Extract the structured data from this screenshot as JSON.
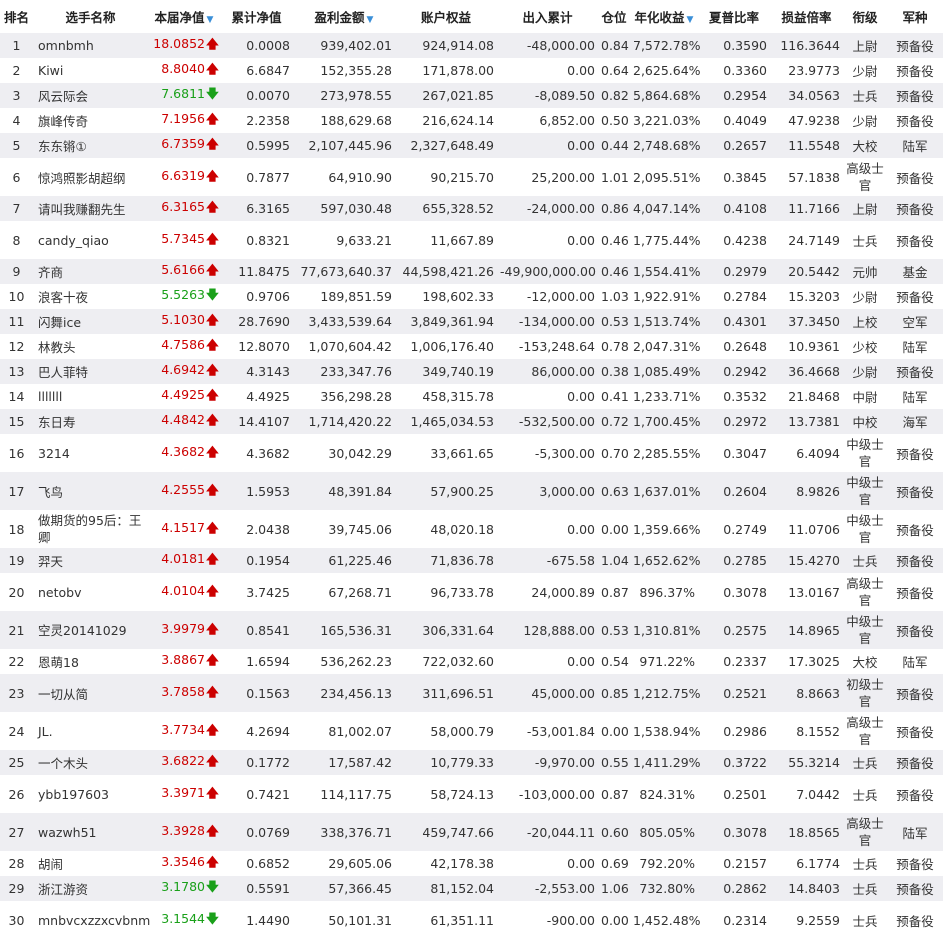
{
  "columns": {
    "rank": "排名",
    "name": "选手名称",
    "nav": "本届净值",
    "cum_nav": "累计净值",
    "profit": "盈利金额",
    "equity": "账户权益",
    "flow": "出入累计",
    "position": "仓位",
    "annual": "年化收益",
    "sharpe": "夏普比率",
    "pl_ratio": "损益倍率",
    "title": "衔级",
    "branch": "军种",
    "sort_indicator": "▼"
  },
  "arrows": {
    "up": "🡅",
    "down": "🡇"
  },
  "colors": {
    "up": "#cc0000",
    "down": "#1aa01a",
    "sort": "#3a8fd8",
    "row_alt": "#eeeef2"
  },
  "rows": [
    {
      "rank": "1",
      "name": "omnbmh",
      "nav": "18.0852",
      "dir": "up",
      "cum_nav": "0.0008",
      "profit": "939,402.01",
      "equity": "924,914.08",
      "flow": "-48,000.00",
      "position": "0.84",
      "annual": "7,572.78%",
      "sharpe": "0.3590",
      "pl_ratio": "116.3644",
      "title": "上尉",
      "branch": "预备役"
    },
    {
      "rank": "2",
      "name": "Kiwi",
      "nav": "8.8040",
      "dir": "up",
      "cum_nav": "6.6847",
      "profit": "152,355.28",
      "equity": "171,878.00",
      "flow": "0.00",
      "position": "0.64",
      "annual": "2,625.64%",
      "sharpe": "0.3360",
      "pl_ratio": "23.9773",
      "title": "少尉",
      "branch": "预备役"
    },
    {
      "rank": "3",
      "name": "风云际会",
      "nav": "7.6811",
      "dir": "down",
      "cum_nav": "0.0070",
      "profit": "273,978.55",
      "equity": "267,021.85",
      "flow": "-8,089.50",
      "position": "0.82",
      "annual": "5,864.68%",
      "sharpe": "0.2954",
      "pl_ratio": "34.0563",
      "title": "士兵",
      "branch": "预备役"
    },
    {
      "rank": "4",
      "name": "旗峰传奇",
      "nav": "7.1956",
      "dir": "up",
      "cum_nav": "2.2358",
      "profit": "188,629.68",
      "equity": "216,624.14",
      "flow": "6,852.00",
      "position": "0.50",
      "annual": "3,221.03%",
      "sharpe": "0.4049",
      "pl_ratio": "47.9238",
      "title": "少尉",
      "branch": "预备役"
    },
    {
      "rank": "5",
      "name": "东东锵①",
      "nav": "6.7359",
      "dir": "up",
      "cum_nav": "0.5995",
      "profit": "2,107,445.96",
      "equity": "2,327,648.49",
      "flow": "0.00",
      "position": "0.44",
      "annual": "2,748.68%",
      "sharpe": "0.2657",
      "pl_ratio": "11.5548",
      "title": "大校",
      "branch": "陆军"
    },
    {
      "rank": "6",
      "name": "惊鸿照影胡超纲",
      "nav": "6.6319",
      "dir": "up",
      "cum_nav": "0.7877",
      "profit": "64,910.90",
      "equity": "90,215.70",
      "flow": "25,200.00",
      "position": "1.01",
      "annual": "2,095.51%",
      "sharpe": "0.3845",
      "pl_ratio": "57.1838",
      "title": "高级士官",
      "branch": "预备役"
    },
    {
      "rank": "7",
      "name": "请叫我赚翻先生",
      "nav": "6.3165",
      "dir": "up",
      "cum_nav": "6.3165",
      "profit": "597,030.48",
      "equity": "655,328.52",
      "flow": "-24,000.00",
      "position": "0.86",
      "annual": "4,047.14%",
      "sharpe": "0.4108",
      "pl_ratio": "11.7166",
      "title": "上尉",
      "branch": "预备役"
    },
    {
      "rank": "8",
      "name": "candy_qiao",
      "nav": "5.7345",
      "dir": "up",
      "cum_nav": "0.8321",
      "profit": "9,633.21",
      "equity": "11,667.89",
      "flow": "0.00",
      "position": "0.46",
      "annual": "1,775.44%",
      "sharpe": "0.4238",
      "pl_ratio": "24.7149",
      "title": "士兵",
      "branch": "预备役"
    },
    {
      "rank": "9",
      "name": "齐商",
      "nav": "5.6166",
      "dir": "up",
      "cum_nav": "11.8475",
      "profit": "77,673,640.37",
      "equity": "44,598,421.26",
      "flow": "-49,900,000.00",
      "position": "0.46",
      "annual": "1,554.41%",
      "sharpe": "0.2979",
      "pl_ratio": "20.5442",
      "title": "元帅",
      "branch": "基金"
    },
    {
      "rank": "10",
      "name": "浪客十夜",
      "nav": "5.5263",
      "dir": "down",
      "cum_nav": "0.9706",
      "profit": "189,851.59",
      "equity": "198,602.33",
      "flow": "-12,000.00",
      "position": "1.03",
      "annual": "1,922.91%",
      "sharpe": "0.2784",
      "pl_ratio": "15.3203",
      "title": "少尉",
      "branch": "预备役"
    },
    {
      "rank": "11",
      "name": "闪舞ice",
      "nav": "5.1030",
      "dir": "up",
      "cum_nav": "28.7690",
      "profit": "3,433,539.64",
      "equity": "3,849,361.94",
      "flow": "-134,000.00",
      "position": "0.53",
      "annual": "1,513.74%",
      "sharpe": "0.4301",
      "pl_ratio": "37.3450",
      "title": "上校",
      "branch": "空军"
    },
    {
      "rank": "12",
      "name": "林教头",
      "nav": "4.7586",
      "dir": "up",
      "cum_nav": "12.8070",
      "profit": "1,070,604.42",
      "equity": "1,006,176.40",
      "flow": "-153,248.64",
      "position": "0.78",
      "annual": "2,047.31%",
      "sharpe": "0.2648",
      "pl_ratio": "10.9361",
      "title": "少校",
      "branch": "陆军"
    },
    {
      "rank": "13",
      "name": "巴人菲特",
      "nav": "4.6942",
      "dir": "up",
      "cum_nav": "4.3143",
      "profit": "233,347.76",
      "equity": "349,740.19",
      "flow": "86,000.00",
      "position": "0.38",
      "annual": "1,085.49%",
      "sharpe": "0.2942",
      "pl_ratio": "36.4668",
      "title": "少尉",
      "branch": "预备役"
    },
    {
      "rank": "14",
      "name": "lllllll",
      "nav": "4.4925",
      "dir": "up",
      "cum_nav": "4.4925",
      "profit": "356,298.28",
      "equity": "458,315.78",
      "flow": "0.00",
      "position": "0.41",
      "annual": "1,233.71%",
      "sharpe": "0.3532",
      "pl_ratio": "21.8468",
      "title": "中尉",
      "branch": "陆军"
    },
    {
      "rank": "15",
      "name": "东日寿",
      "nav": "4.4842",
      "dir": "up",
      "cum_nav": "14.4107",
      "profit": "1,714,420.22",
      "equity": "1,465,034.53",
      "flow": "-532,500.00",
      "position": "0.72",
      "annual": "1,700.45%",
      "sharpe": "0.2972",
      "pl_ratio": "13.7381",
      "title": "中校",
      "branch": "海军"
    },
    {
      "rank": "16",
      "name": "3214",
      "nav": "4.3682",
      "dir": "up",
      "cum_nav": "4.3682",
      "profit": "30,042.29",
      "equity": "33,661.65",
      "flow": "-5,300.00",
      "position": "0.70",
      "annual": "2,285.55%",
      "sharpe": "0.3047",
      "pl_ratio": "6.4094",
      "title": "中级士官",
      "branch": "预备役"
    },
    {
      "rank": "17",
      "name": "飞鸟",
      "nav": "4.2555",
      "dir": "up",
      "cum_nav": "1.5953",
      "profit": "48,391.84",
      "equity": "57,900.25",
      "flow": "3,000.00",
      "position": "0.63",
      "annual": "1,637.01%",
      "sharpe": "0.2604",
      "pl_ratio": "8.9826",
      "title": "中级士官",
      "branch": "预备役"
    },
    {
      "rank": "18",
      "name": "做期货的95后：王卿",
      "nav": "4.1517",
      "dir": "up",
      "cum_nav": "2.0438",
      "profit": "39,745.06",
      "equity": "48,020.18",
      "flow": "0.00",
      "position": "0.00",
      "annual": "1,359.66%",
      "sharpe": "0.2749",
      "pl_ratio": "11.0706",
      "title": "中级士官",
      "branch": "预备役"
    },
    {
      "rank": "19",
      "name": "羿天",
      "nav": "4.0181",
      "dir": "up",
      "cum_nav": "0.1954",
      "profit": "61,225.46",
      "equity": "71,836.78",
      "flow": "-675.58",
      "position": "1.04",
      "annual": "1,652.62%",
      "sharpe": "0.2785",
      "pl_ratio": "15.4270",
      "title": "士兵",
      "branch": "预备役"
    },
    {
      "rank": "20",
      "name": "netobv",
      "nav": "4.0104",
      "dir": "up",
      "cum_nav": "3.7425",
      "profit": "67,268.71",
      "equity": "96,733.78",
      "flow": "24,000.89",
      "position": "0.87",
      "annual": "896.37%",
      "sharpe": "0.3078",
      "pl_ratio": "13.0167",
      "title": "高级士官",
      "branch": "预备役"
    },
    {
      "rank": "21",
      "name": "空灵20141029",
      "nav": "3.9979",
      "dir": "up",
      "cum_nav": "0.8541",
      "profit": "165,536.31",
      "equity": "306,331.64",
      "flow": "128,888.00",
      "position": "0.53",
      "annual": "1,310.81%",
      "sharpe": "0.2575",
      "pl_ratio": "14.8965",
      "title": "中级士官",
      "branch": "预备役"
    },
    {
      "rank": "22",
      "name": "恩萌18",
      "nav": "3.8867",
      "dir": "up",
      "cum_nav": "1.6594",
      "profit": "536,262.23",
      "equity": "722,032.60",
      "flow": "0.00",
      "position": "0.54",
      "annual": "971.22%",
      "sharpe": "0.2337",
      "pl_ratio": "17.3025",
      "title": "大校",
      "branch": "陆军"
    },
    {
      "rank": "23",
      "name": "一切从简",
      "nav": "3.7858",
      "dir": "up",
      "cum_nav": "0.1563",
      "profit": "234,456.13",
      "equity": "311,696.51",
      "flow": "45,000.00",
      "position": "0.85",
      "annual": "1,212.75%",
      "sharpe": "0.2521",
      "pl_ratio": "8.8663",
      "title": "初级士官",
      "branch": "预备役"
    },
    {
      "rank": "24",
      "name": "JL.",
      "nav": "3.7734",
      "dir": "up",
      "cum_nav": "4.2694",
      "profit": "81,002.07",
      "equity": "58,000.79",
      "flow": "-53,001.84",
      "position": "0.00",
      "annual": "1,538.94%",
      "sharpe": "0.2986",
      "pl_ratio": "8.1552",
      "title": "高级士官",
      "branch": "预备役"
    },
    {
      "rank": "25",
      "name": "一个木头",
      "nav": "3.6822",
      "dir": "up",
      "cum_nav": "0.1772",
      "profit": "17,587.42",
      "equity": "10,779.33",
      "flow": "-9,970.00",
      "position": "0.55",
      "annual": "1,411.29%",
      "sharpe": "0.3722",
      "pl_ratio": "55.3214",
      "title": "士兵",
      "branch": "预备役"
    },
    {
      "rank": "26",
      "name": "ybb197603",
      "nav": "3.3971",
      "dir": "up",
      "cum_nav": "0.7421",
      "profit": "114,117.75",
      "equity": "58,724.13",
      "flow": "-103,000.00",
      "position": "0.87",
      "annual": "824.31%",
      "sharpe": "0.2501",
      "pl_ratio": "7.0442",
      "title": "士兵",
      "branch": "预备役"
    },
    {
      "rank": "27",
      "name": "wazwh51",
      "nav": "3.3928",
      "dir": "up",
      "cum_nav": "0.0769",
      "profit": "338,376.71",
      "equity": "459,747.66",
      "flow": "-20,044.11",
      "position": "0.60",
      "annual": "805.05%",
      "sharpe": "0.3078",
      "pl_ratio": "18.8565",
      "title": "高级士官",
      "branch": "陆军"
    },
    {
      "rank": "28",
      "name": "胡闹",
      "nav": "3.3546",
      "dir": "up",
      "cum_nav": "0.6852",
      "profit": "29,605.06",
      "equity": "42,178.38",
      "flow": "0.00",
      "position": "0.69",
      "annual": "792.20%",
      "sharpe": "0.2157",
      "pl_ratio": "6.1774",
      "title": "士兵",
      "branch": "预备役"
    },
    {
      "rank": "29",
      "name": "浙江游资",
      "nav": "3.1780",
      "dir": "down",
      "cum_nav": "0.5591",
      "profit": "57,366.45",
      "equity": "81,152.04",
      "flow": "-2,553.00",
      "position": "1.06",
      "annual": "732.80%",
      "sharpe": "0.2862",
      "pl_ratio": "14.8403",
      "title": "士兵",
      "branch": "预备役"
    },
    {
      "rank": "30",
      "name": "mnbvcxzzxcvbnm",
      "nav": "3.1544",
      "dir": "down",
      "cum_nav": "1.4490",
      "profit": "50,101.31",
      "equity": "61,351.11",
      "flow": "-900.00",
      "position": "0.00",
      "annual": "1,452.48%",
      "sharpe": "0.2314",
      "pl_ratio": "9.2559",
      "title": "士兵",
      "branch": "预备役"
    }
  ]
}
